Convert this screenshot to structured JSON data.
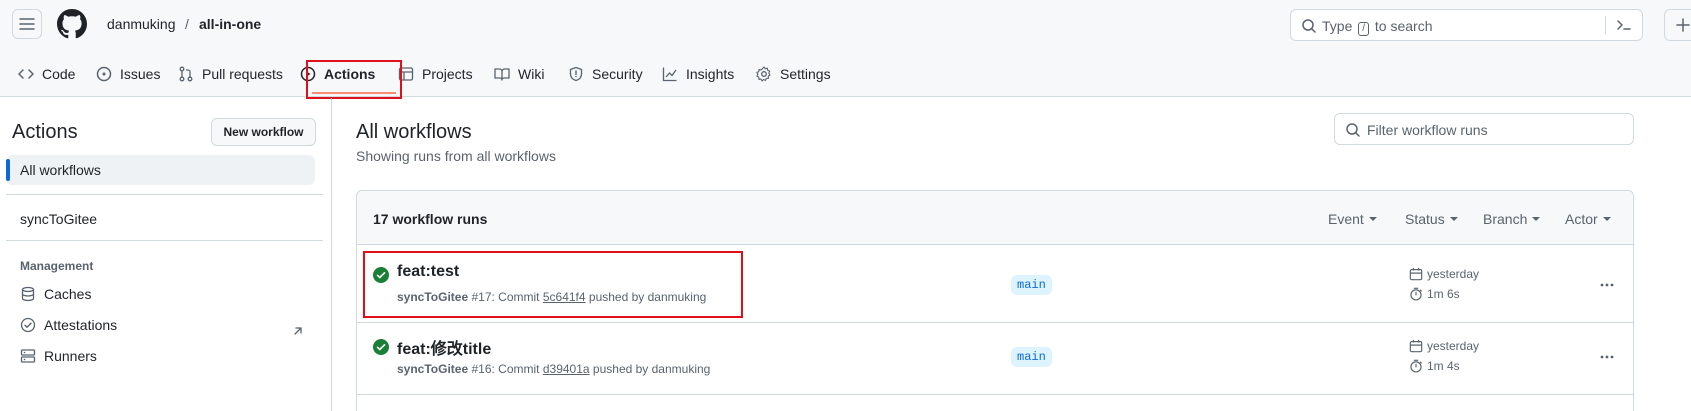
{
  "header": {
    "owner": "danmuking",
    "separator": "/",
    "repo": "all-in-one",
    "search_prefix": "Type",
    "search_key": "/",
    "search_suffix": "to search"
  },
  "repo_nav": {
    "tabs": [
      {
        "label": "Code",
        "icon": "code-icon"
      },
      {
        "label": "Issues",
        "icon": "issue-icon"
      },
      {
        "label": "Pull requests",
        "icon": "pull-request-icon"
      },
      {
        "label": "Actions",
        "icon": "play-icon",
        "selected": true
      },
      {
        "label": "Projects",
        "icon": "table-icon"
      },
      {
        "label": "Wiki",
        "icon": "book-icon"
      },
      {
        "label": "Security",
        "icon": "shield-icon"
      },
      {
        "label": "Insights",
        "icon": "graph-icon"
      },
      {
        "label": "Settings",
        "icon": "gear-icon"
      }
    ]
  },
  "sidebar": {
    "title": "Actions",
    "new_workflow_label": "New workflow",
    "all_workflows": "All workflows",
    "workflows": [
      "syncToGitee"
    ],
    "management_heading": "Management",
    "management_items": [
      {
        "label": "Caches",
        "icon": "database-icon"
      },
      {
        "label": "Attestations",
        "icon": "verified-icon"
      },
      {
        "label": "Runners",
        "icon": "server-icon"
      }
    ]
  },
  "main": {
    "title": "All workflows",
    "subtitle": "Showing runs from all workflows",
    "filter_placeholder": "Filter workflow runs",
    "runs_count": "17 workflow runs",
    "filters": [
      "Event",
      "Status",
      "Branch",
      "Actor"
    ],
    "runs": [
      {
        "title": "feat:test",
        "workflow": "syncToGitee",
        "number": "#17: Commit",
        "sha": "5c641f4",
        "pushed_by": "pushed by danmuking",
        "branch": "main",
        "when": "yesterday",
        "duration": "1m 6s",
        "status": "success"
      },
      {
        "title": "feat:修改title",
        "workflow": "syncToGitee",
        "number": "#16: Commit",
        "sha": "d39401a",
        "pushed_by": "pushed by danmuking",
        "branch": "main",
        "when": "yesterday",
        "duration": "1m 4s",
        "status": "success"
      }
    ]
  },
  "colors": {
    "accent": "#0969da",
    "success": "#1a7f37",
    "highlight": "#e0101a"
  }
}
